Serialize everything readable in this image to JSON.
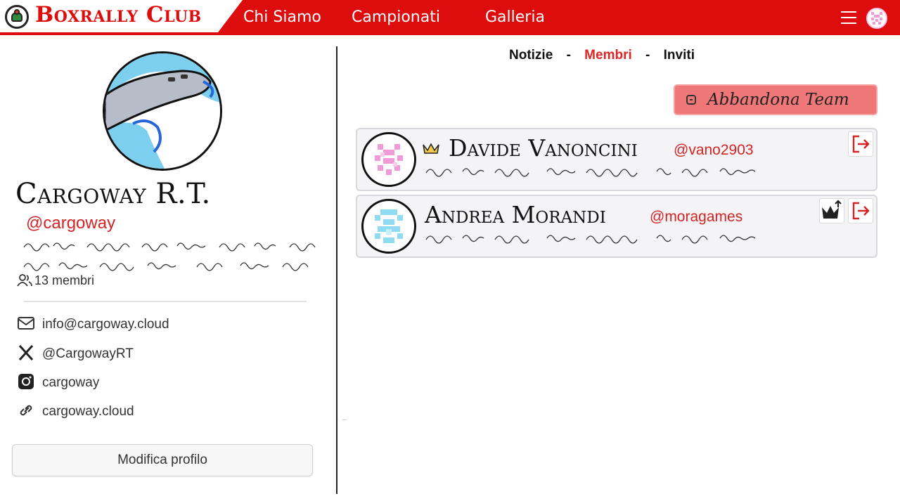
{
  "header": {
    "brand": "Boxrally Club",
    "nav": [
      "Chi Siamo",
      "Campionati",
      "Galleria"
    ]
  },
  "team": {
    "name": "Cargoway R.T.",
    "handle": "@cargoway",
    "members": "13 membri",
    "contacts": {
      "email": "info@cargoway.cloud",
      "x": "@CargowayRT",
      "instagram": "cargoway",
      "website": "cargoway.cloud"
    },
    "edit_label": "Modifica profilo"
  },
  "tabs": {
    "items": [
      "Notizie",
      "Membri",
      "Inviti"
    ],
    "separator": "-",
    "active": "Membri"
  },
  "leave_team_label": "Abbandona Team",
  "members": [
    {
      "name": "Davide Vanoncini",
      "handle": "@vano2903",
      "role": "captain",
      "avatar_color": "#f09ad8"
    },
    {
      "name": "Andrea Morandi",
      "handle": "@moragames",
      "role": "member",
      "avatar_color": "#8fdcf2"
    }
  ],
  "colors": {
    "brand_red": "#de0d0d",
    "handle_red": "#d42424",
    "leave_button": "#ef7777",
    "crown": "#f2c94c"
  },
  "icons": [
    "hamburger-icon",
    "users-icon",
    "mail-icon",
    "x-logo-icon",
    "instagram-icon",
    "link-icon",
    "crown-icon",
    "logout-icon",
    "promote-icon"
  ]
}
